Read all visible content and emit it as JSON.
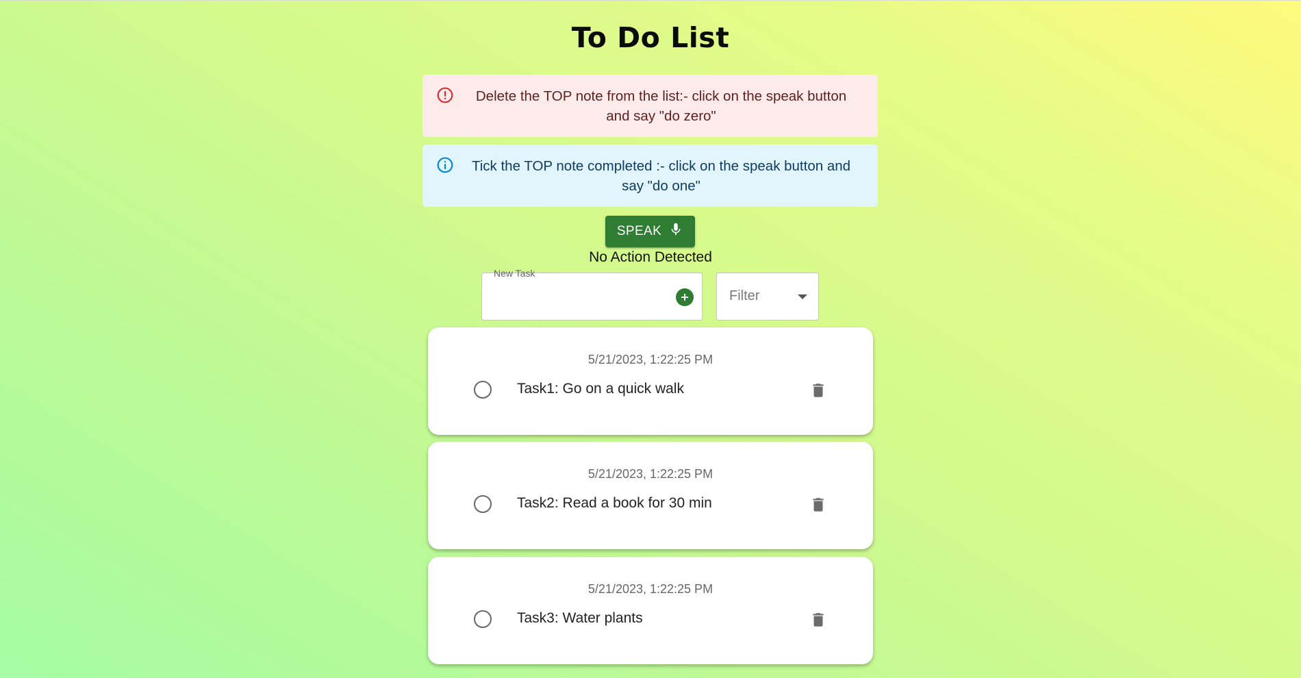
{
  "header": {
    "title": "To Do List"
  },
  "alerts": {
    "error": {
      "text": "Delete the TOP note from the list:- click on the speak button and say \"do zero\"",
      "icon": "error-outline-icon",
      "color": "#d32f2f"
    },
    "info": {
      "text": "Tick the TOP note completed :- click on the speak button and say \"do one\"",
      "icon": "info-outline-icon",
      "color": "#0288d1"
    }
  },
  "speak": {
    "label": "SPEAK",
    "icon": "microphone-icon",
    "color": "#2e7d32"
  },
  "status": {
    "text": "No Action Detected"
  },
  "new_task": {
    "label": "New Task",
    "value": "",
    "add_icon": "add-circle-icon"
  },
  "filter": {
    "placeholder": "Filter",
    "icon": "dropdown-arrow-icon"
  },
  "tasks": [
    {
      "timestamp": "5/21/2023, 1:22:25 PM",
      "text": "Task1: Go on a quick walk",
      "completed": false
    },
    {
      "timestamp": "5/21/2023, 1:22:25 PM",
      "text": "Task2: Read a book for 30 min",
      "completed": false
    },
    {
      "timestamp": "5/21/2023, 1:22:25 PM",
      "text": "Task3: Water plants",
      "completed": false
    }
  ]
}
